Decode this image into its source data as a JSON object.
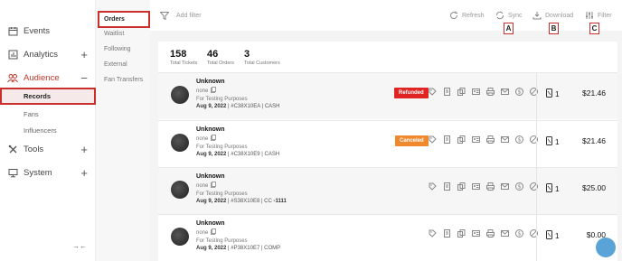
{
  "nav": {
    "items": [
      {
        "label": "Events",
        "icon": "calendar-icon",
        "expand": ""
      },
      {
        "label": "Analytics",
        "icon": "analytics-icon",
        "expand": "+"
      },
      {
        "label": "Audience",
        "icon": "audience-icon",
        "expand": "−"
      },
      {
        "label": "Tools",
        "icon": "tools-icon",
        "expand": "+"
      },
      {
        "label": "System",
        "icon": "monitor-icon",
        "expand": "+"
      }
    ],
    "audience_sub": [
      "Records",
      "Fans",
      "Influencers"
    ],
    "collapse_glyph": "→←"
  },
  "subnav": {
    "items": [
      "Orders",
      "Waitlist",
      "Following",
      "External",
      "Fan Transfers"
    ]
  },
  "toolbar": {
    "add_filter": "Add filter",
    "refresh": "Refresh",
    "sync": "Sync",
    "download": "Download",
    "filter": "Filter",
    "callouts": [
      "A",
      "B",
      "C"
    ]
  },
  "stats": [
    {
      "value": "158",
      "label": "Total Tickets"
    },
    {
      "value": "46",
      "label": "Total Orders"
    },
    {
      "value": "3",
      "label": "Total Customers"
    }
  ],
  "orders": [
    {
      "name": "Unknown",
      "email": "none",
      "purpose": "For Testing Purposes",
      "date": "Aug 9, 2022",
      "meta": " | #C38X10EA | CASH",
      "badge": "Refunded",
      "qty": "1",
      "price": "$21.46"
    },
    {
      "name": "Unknown",
      "email": "none",
      "purpose": "For Testing Purposes",
      "date": "Aug 9, 2022",
      "meta": " | #C38X10E9 | CASH",
      "badge": "Canceled",
      "qty": "1",
      "price": "$21.46"
    },
    {
      "name": "Unknown",
      "email": "none",
      "purpose": "For Testing Purposes",
      "date": "Aug 9, 2022",
      "meta": " | #S38X10E8 | CC ",
      "meta_bold": "-1111",
      "badge": "",
      "qty": "1",
      "price": "$25.00"
    },
    {
      "name": "Unknown",
      "email": "none",
      "purpose": "For Testing Purposes",
      "date": "Aug 9, 2022",
      "meta": " | #P38X10E7 | COMP",
      "badge": "",
      "qty": "1",
      "price": "$0.00"
    }
  ],
  "colors": {
    "accent": "#c9302c",
    "refunded": "#e02424",
    "canceled": "#f0892e",
    "fab": "#5aa3d6"
  }
}
